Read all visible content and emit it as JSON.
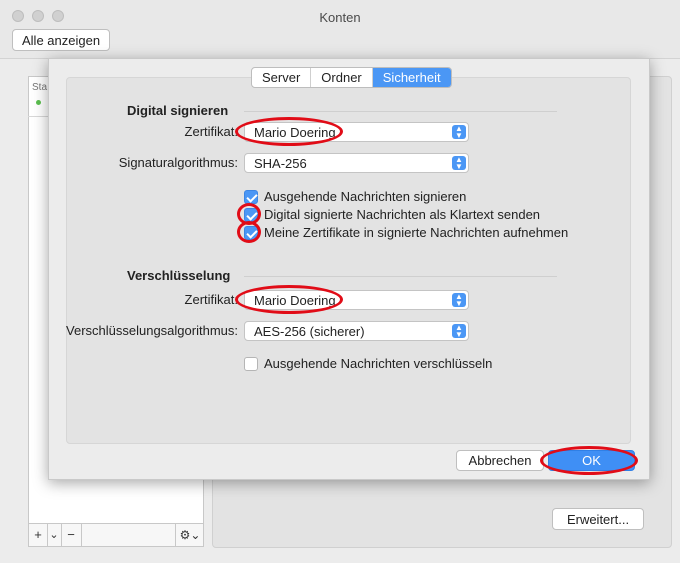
{
  "window": {
    "title": "Konten",
    "show_all_label": "Alle anzeigen"
  },
  "background": {
    "list_header_partial": "Sta",
    "add_label": "+",
    "add_menu_label": "⌄",
    "remove_label": "−",
    "gear_label": "⚙⌄",
    "advanced_label": "Erweitert..."
  },
  "sheet": {
    "tabs": [
      {
        "label": "Server",
        "active": false
      },
      {
        "label": "Ordner",
        "active": false
      },
      {
        "label": "Sicherheit",
        "active": true
      }
    ],
    "signing": {
      "title": "Digital signieren",
      "certificate_label": "Zertifikat:",
      "certificate_value": "Mario Doering",
      "algorithm_label": "Signaturalgorithmus:",
      "algorithm_value": "SHA-256",
      "options": [
        {
          "label": "Ausgehende Nachrichten signieren",
          "checked": true
        },
        {
          "label": "Digital signierte Nachrichten als Klartext senden",
          "checked": true
        },
        {
          "label": "Meine Zertifikate in signierte Nachrichten aufnehmen",
          "checked": true
        }
      ]
    },
    "encryption": {
      "title": "Verschlüsselung",
      "certificate_label": "Zertifikat:",
      "certificate_value": "Mario Doering",
      "algorithm_label": "Verschlüsselungsalgorithmus:",
      "algorithm_value": "AES-256 (sicherer)",
      "options": [
        {
          "label": "Ausgehende Nachrichten verschlüsseln",
          "checked": false
        }
      ]
    },
    "cancel_label": "Abbrechen",
    "ok_label": "OK"
  },
  "colors": {
    "accent": "#4b97f5",
    "annotation": "#e10c17"
  }
}
